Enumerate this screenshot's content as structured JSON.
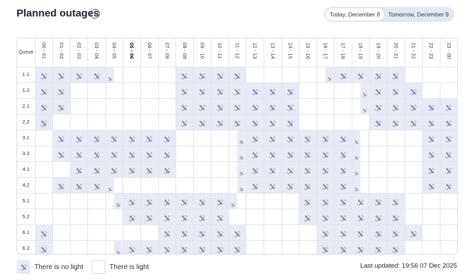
{
  "header": {
    "title": "Planned outages",
    "info_icon": "i"
  },
  "day_switch": {
    "today_label": "Today, December 8",
    "tomorrow_label": "Tomorrow, December 9",
    "selected": "today"
  },
  "table": {
    "corner_label": "Queue",
    "current_hour_index": 5,
    "hours": [
      "00 - 01",
      "01 - 02",
      "02 - 03",
      "03 - 04",
      "04 - 05",
      "05 - 06",
      "06 - 07",
      "07 - 08",
      "08 - 09",
      "09 - 10",
      "10 - 11",
      "11 - 12",
      "12 - 13",
      "13 - 14",
      "14 - 15",
      "15 - 16",
      "16 - 17",
      "17 - 18",
      "18 - 19",
      "19 - 20",
      "20 - 21",
      "21 - 22",
      "22 - 23",
      "23 - 00"
    ],
    "status_legend": {
      "F": "no light, full hour",
      "L": "no light, first half hour",
      "R": "no light, second half hour",
      ".": "light"
    },
    "rows": [
      {
        "queue": "1.1",
        "cells": "FFFFL...FFFF....RFFFF.."
      },
      {
        "queue": "1.2",
        "cells": "FF......FFFFFFF...RFFF.."
      },
      {
        "queue": "2.1",
        "cells": "FF......FFFFFFF...RFFFFF"
      },
      {
        "queue": "2.2",
        "cells": "F.......FFFFFFF....FFFFF"
      },
      {
        "queue": "3.1",
        "cells": ".FFFFFFF...RFFFFFFL...FF"
      },
      {
        "queue": "3.2",
        "cells": ".FFFFFFF...RFFFFFFL...FF"
      },
      {
        "queue": "4.1",
        "cells": "..FFFFFF...RFFFFFFL...FF"
      },
      {
        "queue": "4.2",
        "cells": ".FFFL......RFFFFFFL...FF"
      },
      {
        "queue": "5.1",
        "cells": "....RFFFFFFL...FFFFFF..."
      },
      {
        "queue": "5.2",
        "cells": ".....FFFFFF....FFFFFF..."
      },
      {
        "queue": "6.1",
        "cells": "F......FFFFF....FFFFFF.."
      },
      {
        "queue": "6.2",
        "cells": "F...RFFFFFFF....FFFFF..."
      }
    ]
  },
  "legend": {
    "no_light_label": "There is no light",
    "light_label": "There is light"
  },
  "footer": {
    "last_updated": "Last updated: 19:56 07 Dec 2025"
  },
  "colors": {
    "outage_fill": "#e8eaf5",
    "icon": "#8b90a8",
    "grid_line": "#e1e5ec"
  },
  "icons": {
    "outage": "no-power-icon",
    "info": "info-icon"
  }
}
